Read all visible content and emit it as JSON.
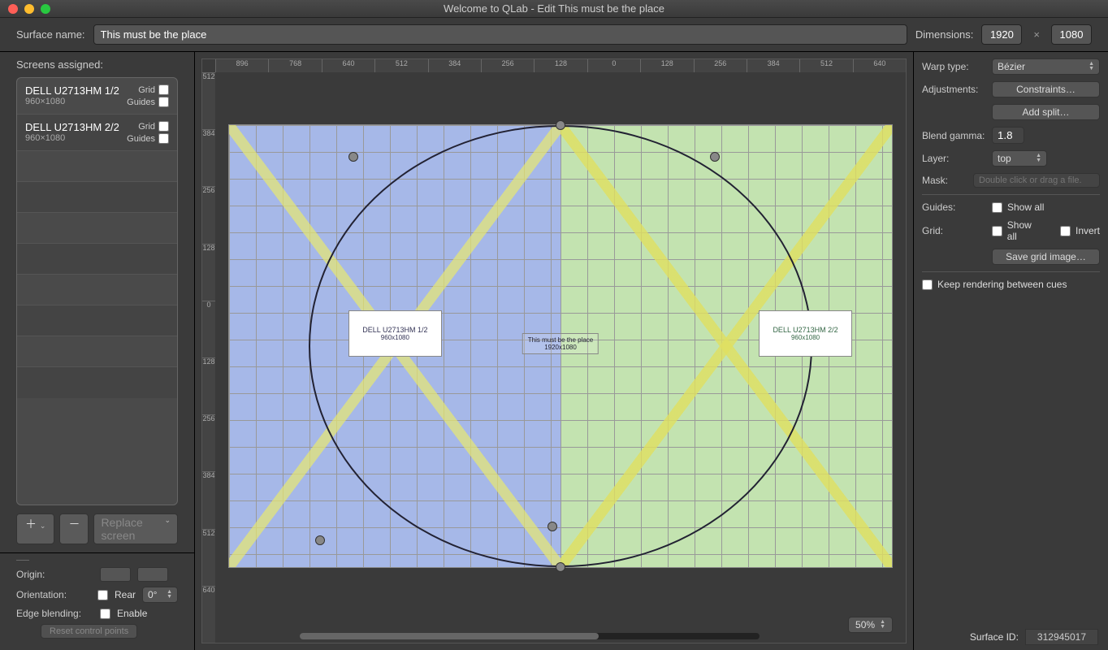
{
  "window": {
    "title": "Welcome to QLab - Edit This must be the place"
  },
  "top": {
    "surface_name_label": "Surface name:",
    "surface_name": "This must be the place",
    "dimensions_label": "Dimensions:",
    "width": "1920",
    "height": "1080",
    "x": "×"
  },
  "left": {
    "header": "Screens assigned:",
    "screens": [
      {
        "name": "DELL U2713HM 1/2",
        "res": "960×1080",
        "grid_label": "Grid",
        "guides_label": "Guides"
      },
      {
        "name": "DELL U2713HM 2/2",
        "res": "960×1080",
        "grid_label": "Grid",
        "guides_label": "Guides"
      }
    ],
    "add": "＋",
    "add_chev": "⌄",
    "remove": "－",
    "replace": "Replace screen",
    "replace_chev": "⌄"
  },
  "props": {
    "origin_label": "Origin:",
    "orientation_label": "Orientation:",
    "rear_label": "Rear",
    "angle": "0°",
    "edge_label": "Edge blending:",
    "enable_label": "Enable",
    "reset": "Reset control points"
  },
  "canvas": {
    "ruler_h": [
      "896",
      "768",
      "640",
      "512",
      "384",
      "256",
      "128",
      "0",
      "128",
      "256",
      "384",
      "512",
      "640"
    ],
    "ruler_v": [
      "512",
      "384",
      "256",
      "128",
      "0",
      "128",
      "256",
      "384",
      "512",
      "640"
    ],
    "mon1": {
      "name": "DELL U2713HM 1/2",
      "res": "960x1080"
    },
    "mon2": {
      "name": "DELL U2713HM 2/2",
      "res": "960x1080"
    },
    "center": {
      "name": "This must be the place",
      "res": "1920x1080"
    },
    "zoom": "50%"
  },
  "right": {
    "warp_label": "Warp type:",
    "warp_value": "Bézier",
    "adjust_label": "Adjustments:",
    "constraints": "Constraints…",
    "addsplit": "Add split…",
    "gamma_label": "Blend gamma:",
    "gamma_value": "1.8",
    "layer_label": "Layer:",
    "layer_value": "top",
    "mask_label": "Mask:",
    "mask_placeholder": "Double click or drag a file.",
    "guides_label": "Guides:",
    "showall1": "Show all",
    "grid_label": "Grid:",
    "showall2": "Show all",
    "invert": "Invert",
    "savegrid": "Save grid image…",
    "keep_render": "Keep rendering between cues",
    "surface_id_label": "Surface ID:",
    "surface_id": "312945017"
  }
}
